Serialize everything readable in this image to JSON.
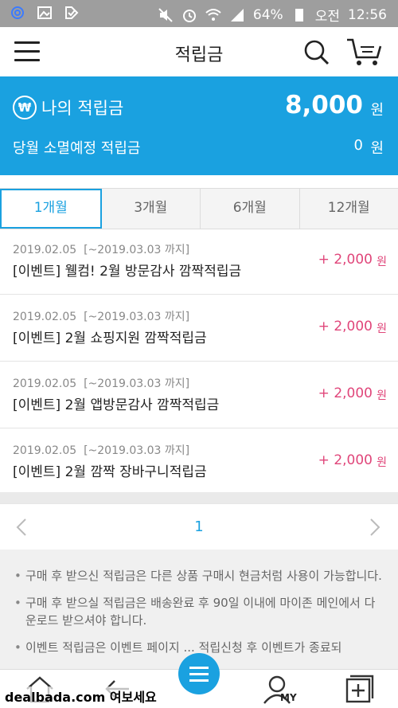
{
  "statusbar": {
    "battery": "64%",
    "ampm": "오전",
    "time": "12:56"
  },
  "header": {
    "title": "적립금"
  },
  "summary": {
    "my_label": "나의 적립금",
    "my_amount": "8,000",
    "unit": "원",
    "expire_label": "당월 소멸예정 적립금",
    "expire_amount": "0",
    "currency_symbol": "₩"
  },
  "tabs": [
    {
      "label": "1개월",
      "active": true
    },
    {
      "label": "3개월",
      "active": false
    },
    {
      "label": "6개월",
      "active": false
    },
    {
      "label": "12개월",
      "active": false
    }
  ],
  "items": [
    {
      "date": "2019.02.05",
      "expiry": "[~2019.03.03 까지]",
      "name": "[이벤트] 웰컴! 2월 방문감사 깜짝적립금",
      "points": "+ 2,000",
      "unit": "원"
    },
    {
      "date": "2019.02.05",
      "expiry": "[~2019.03.03 까지]",
      "name": "[이벤트] 2월 쇼핑지원 깜짝적립금",
      "points": "+ 2,000",
      "unit": "원"
    },
    {
      "date": "2019.02.05",
      "expiry": "[~2019.03.03 까지]",
      "name": "[이벤트] 2월 앱방문감사 깜짝적립금",
      "points": "+ 2,000",
      "unit": "원"
    },
    {
      "date": "2019.02.05",
      "expiry": "[~2019.03.03 까지]",
      "name": "[이벤트] 2월 깜짝 장바구니적립금",
      "points": "+ 2,000",
      "unit": "원"
    }
  ],
  "pagination": {
    "current": "1"
  },
  "notes": [
    "구매 후 받으신 적립금은 다른 상품 구매시 현금처럼 사용이 가능합니다.",
    "구매 후 받으실 적립금은 배송완료 후 90일 이내에 마이존 메인에서 다운로드 받으셔야 합니다.",
    "이벤트 적립금은 이벤트 페이지 ... 적립신청 후 이벤트가 종료되"
  ],
  "bottom_nav": {
    "my_label": "MY"
  },
  "watermark": "dealbada.com 여보세요"
}
